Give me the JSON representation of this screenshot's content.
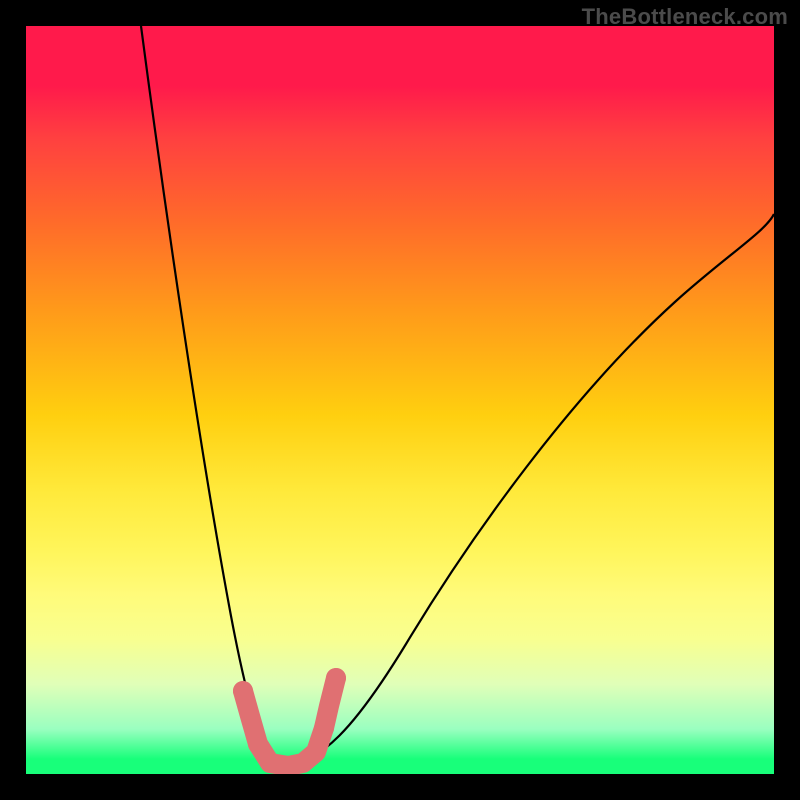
{
  "watermark": "TheBottleneck.com",
  "chart_data": {
    "type": "line",
    "title": "",
    "xlabel": "",
    "ylabel": "",
    "xlim": [
      0,
      100
    ],
    "ylim": [
      0,
      100
    ],
    "grid": false,
    "legend": false,
    "series": [
      {
        "name": "left-curve",
        "x": [
          16,
          18,
          20,
          22,
          24,
          26,
          28,
          30,
          32,
          33
        ],
        "values": [
          100,
          80,
          62,
          46,
          33,
          22,
          13,
          6,
          1,
          0
        ]
      },
      {
        "name": "right-curve",
        "x": [
          33,
          36,
          40,
          46,
          54,
          64,
          76,
          90,
          100
        ],
        "values": [
          0,
          1,
          4,
          10,
          20,
          34,
          50,
          66,
          75
        ]
      },
      {
        "name": "bead-overlay",
        "x": [
          29,
          30,
          31,
          32,
          33,
          34,
          35,
          37,
          38,
          39,
          40
        ],
        "values": [
          10,
          5,
          2,
          0,
          0,
          0,
          0,
          1,
          4,
          8,
          12
        ]
      }
    ],
    "background_gradient_stops": [
      {
        "pos": 0,
        "color": "#ff1a4b"
      },
      {
        "pos": 50,
        "color": "#ffcf0f"
      },
      {
        "pos": 80,
        "color": "#f8ff90"
      },
      {
        "pos": 100,
        "color": "#18ff7a"
      }
    ]
  }
}
